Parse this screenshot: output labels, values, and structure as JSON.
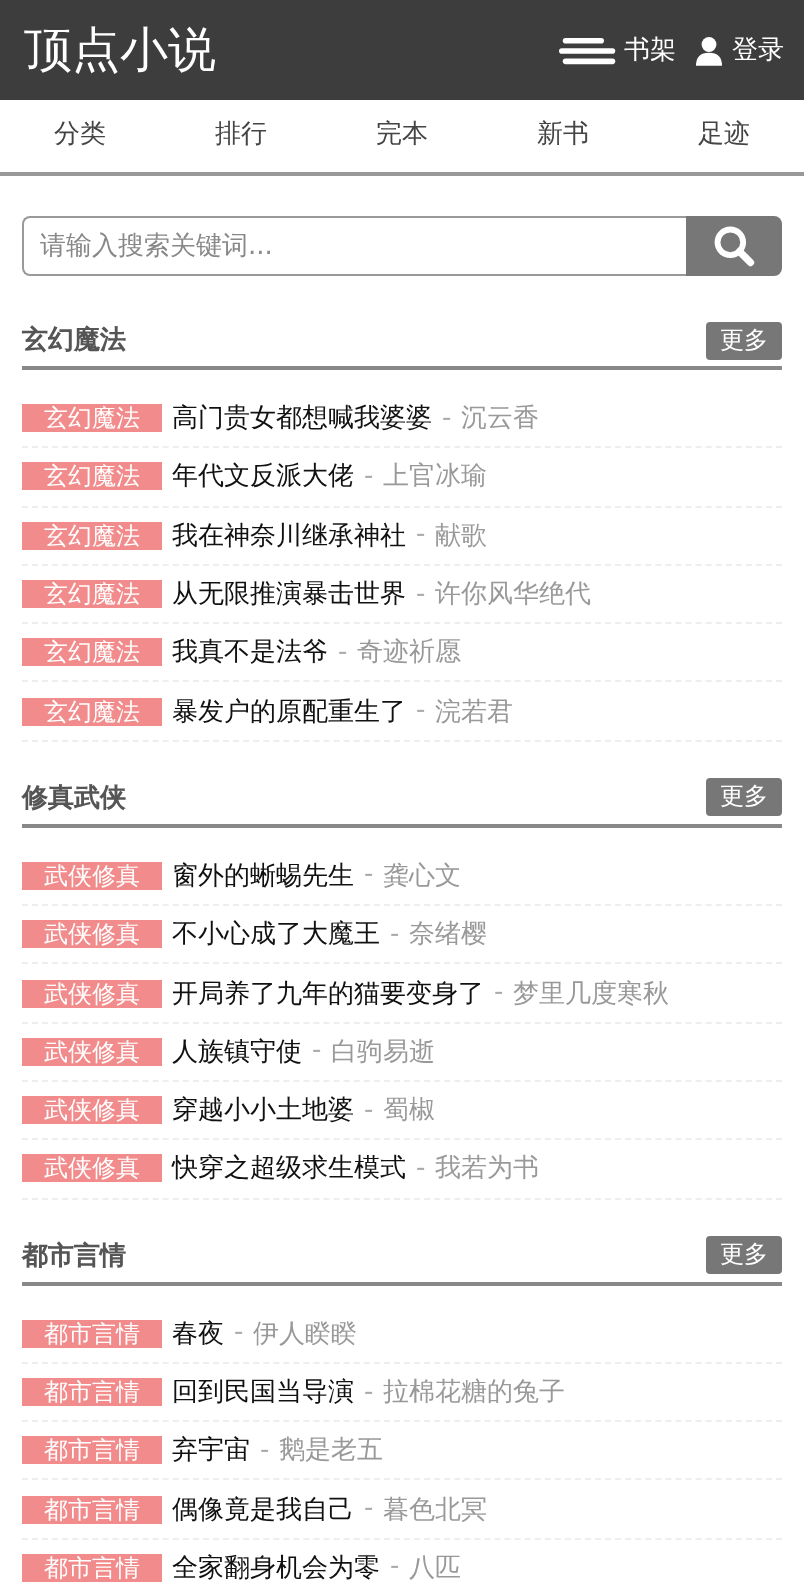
{
  "header": {
    "title": "顶点小说",
    "links": [
      {
        "kind": "shelf",
        "label": "书架"
      },
      {
        "kind": "user",
        "label": "登录"
      }
    ]
  },
  "nav": [
    "分类",
    "排行",
    "完本",
    "新书",
    "足迹"
  ],
  "search": {
    "placeholder": "请输入搜索关键词..."
  },
  "sections": [
    {
      "title": "玄幻魔法",
      "more": "更多",
      "books": [
        {
          "tag": "玄幻魔法",
          "title": "高门贵女都想喊我婆婆",
          "dash": "-",
          "author": "沉云香"
        },
        {
          "tag": "玄幻魔法",
          "title": "年代文反派大佬",
          "dash": "-",
          "author": "上官冰瑜"
        },
        {
          "tag": "玄幻魔法",
          "title": "我在神奈川继承神社",
          "dash": "-",
          "author": "献歌"
        },
        {
          "tag": "玄幻魔法",
          "title": "从无限推演暴击世界",
          "dash": "-",
          "author": "许你风华绝代"
        },
        {
          "tag": "玄幻魔法",
          "title": "我真不是法爷",
          "dash": "-",
          "author": "奇迹祈愿"
        },
        {
          "tag": "玄幻魔法",
          "title": "暴发户的原配重生了",
          "dash": "-",
          "author": "浣若君"
        }
      ]
    },
    {
      "title": "修真武侠",
      "more": "更多",
      "books": [
        {
          "tag": "武侠修真",
          "title": "窗外的蜥蜴先生",
          "dash": "-",
          "author": "龚心文"
        },
        {
          "tag": "武侠修真",
          "title": "不小心成了大魔王",
          "dash": "-",
          "author": "奈绪樱"
        },
        {
          "tag": "武侠修真",
          "title": "开局养了九年的猫要变身了",
          "dash": "-",
          "author": "梦里几度寒秋"
        },
        {
          "tag": "武侠修真",
          "title": "人族镇守使",
          "dash": "-",
          "author": "白驹易逝"
        },
        {
          "tag": "武侠修真",
          "title": "穿越小小土地婆",
          "dash": "-",
          "author": "蜀椒"
        },
        {
          "tag": "武侠修真",
          "title": "快穿之超级求生模式",
          "dash": "-",
          "author": "我若为书"
        }
      ]
    },
    {
      "title": "都市言情",
      "more": "更多",
      "books": [
        {
          "tag": "都市言情",
          "title": "春夜",
          "dash": "-",
          "author": "伊人睽睽"
        },
        {
          "tag": "都市言情",
          "title": "回到民国当导演",
          "dash": "-",
          "author": "拉棉花糖的兔子"
        },
        {
          "tag": "都市言情",
          "title": "弃宇宙",
          "dash": "-",
          "author": "鹅是老五"
        },
        {
          "tag": "都市言情",
          "title": "偶像竟是我自己",
          "dash": "-",
          "author": "暮色北冥"
        },
        {
          "tag": "都市言情",
          "title": "全家翻身机会为零",
          "dash": "-",
          "author": "八匹"
        }
      ]
    }
  ]
}
